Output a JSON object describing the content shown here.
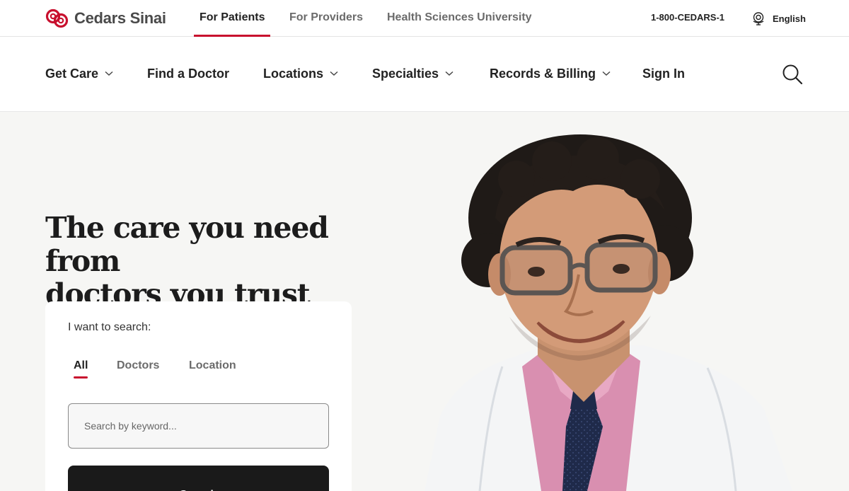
{
  "brand": {
    "name": "Cedars Sinai",
    "color": "#c8102e"
  },
  "top_tabs": [
    {
      "label": "For Patients",
      "active": true
    },
    {
      "label": "For Providers",
      "active": false
    },
    {
      "label": "Health Sciences University",
      "active": false
    }
  ],
  "utility": {
    "phone": "1-800-CEDARS-1",
    "language": "English",
    "language_icon": "globe-icon"
  },
  "main_nav": [
    {
      "label": "Get Care",
      "has_dropdown": true
    },
    {
      "label": "Find a Doctor",
      "has_dropdown": false
    },
    {
      "label": "Locations",
      "has_dropdown": true
    },
    {
      "label": "Specialties",
      "has_dropdown": true
    },
    {
      "label": "Records & Billing",
      "has_dropdown": true
    },
    {
      "label": "Sign In",
      "has_dropdown": false
    }
  ],
  "hero": {
    "title_line1": "The care you need from",
    "title_line2": "doctors you trust"
  },
  "search_card": {
    "label": "I want to search:",
    "tabs": [
      {
        "label": "All",
        "active": true
      },
      {
        "label": "Doctors",
        "active": false
      },
      {
        "label": "Location",
        "active": false
      }
    ],
    "placeholder": "Search by keyword...",
    "button": "Search"
  },
  "colors": {
    "accent": "#c8102e",
    "hero_bg": "#f6f6f4",
    "button_bg": "#1a1a1a"
  }
}
